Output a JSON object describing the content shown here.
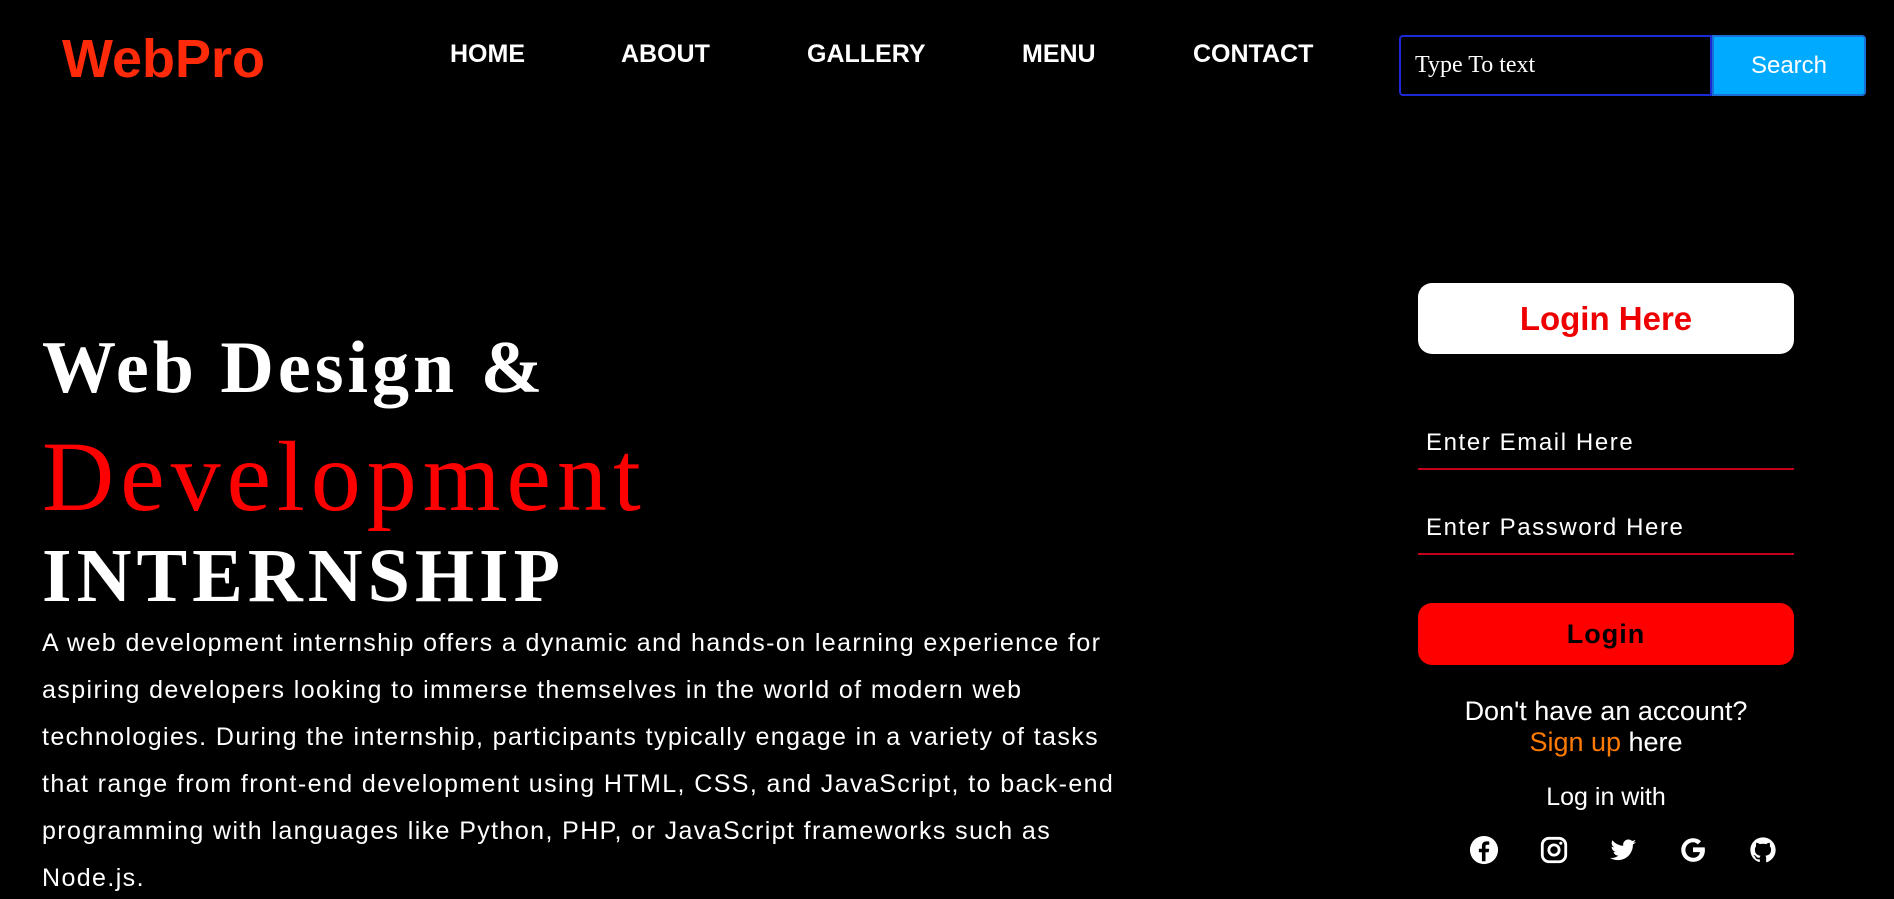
{
  "header": {
    "logo": "WebPro",
    "nav": [
      {
        "label": "HOME"
      },
      {
        "label": "ABOUT"
      },
      {
        "label": "GALLERY"
      },
      {
        "label": "MENU"
      },
      {
        "label": "CONTACT"
      }
    ],
    "search": {
      "placeholder": "Type To text",
      "button_label": "Search"
    }
  },
  "hero": {
    "line1": "Web Design &",
    "line2": "Development",
    "line3": "INTERNSHIP",
    "description": "A web development internship offers a dynamic and hands-on learning experience for aspiring developers looking to immerse themselves in the world of modern web technologies. During the internship, participants typically engage in a variety of tasks that range from front-end development using HTML, CSS, and JavaScript, to back-end programming with languages like Python, PHP, or JavaScript frameworks such as Node.js."
  },
  "login": {
    "title": "Login Here",
    "email_placeholder": "Enter Email Here",
    "password_placeholder": "Enter Password Here",
    "button_label": "Login",
    "no_account_text": "Don't have an account?",
    "signup_link": "Sign up",
    "signup_suffix": " here",
    "login_with": "Log in with",
    "socials": [
      "facebook-icon",
      "instagram-icon",
      "twitter-icon",
      "google-icon",
      "github-icon"
    ]
  },
  "colors": {
    "background": "#000000",
    "logo": "#ff2a0a",
    "accent_red": "#ff0000",
    "search_button": "#00aaff",
    "signup_link": "#ff7a00"
  }
}
